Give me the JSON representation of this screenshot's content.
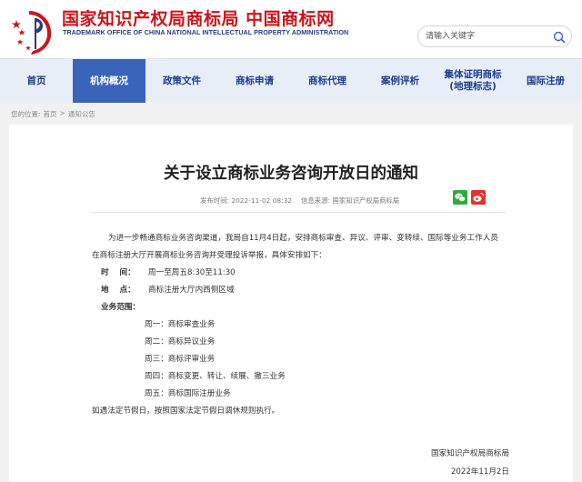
{
  "header": {
    "title": "国家知识产权局商标局 中国商标网",
    "subtitle": "TRADEMARK OFFICE OF CHINA NATIONAL INTELLECTUAL PROPERTY ADMINISTRATION",
    "search": {
      "placeholder": "请输入关键字"
    }
  },
  "nav": {
    "items": [
      {
        "label": "首页"
      },
      {
        "label": "机构概况",
        "active": true
      },
      {
        "label": "政策文件"
      },
      {
        "label": "商标申请"
      },
      {
        "label": "商标代理"
      },
      {
        "label": "案例评析"
      },
      {
        "label": "集体证明商标\n(地理标志)"
      },
      {
        "label": "国际注册"
      }
    ]
  },
  "breadcrumb": {
    "prefix": "您的位置:",
    "items": [
      "首页",
      "通知公告"
    ],
    "separator": ">"
  },
  "article": {
    "title": "关于设立商标业务咨询开放日的通知",
    "published": "发布时间: 2022-11-02 08:32",
    "source": "信息来源: 国家知识产权局商标局",
    "intro": "为进一步畅通商标业务咨询渠道，我局自11月4日起，安排商标审查、异议、评审、变转续、国际等业务工作人员在商标注册大厅开展商标业务咨询并受理投诉举报，具体安排如下：",
    "time_label": "时    间：",
    "time_value": "周一至周五8:30至11:30",
    "place_label": "地    点：",
    "place_value": "商标注册大厅内西侧区域",
    "scope_label": "业务范围：",
    "schedule": [
      "周一：商标审查业务",
      "周二：商标异议业务",
      "周三：商标评审业务",
      "周四：商标变更、转让、续展、撤三业务",
      "周五：商标国际注册业务"
    ],
    "holiday_note": "如遇法定节假日，按照国家法定节假日调休规则执行。",
    "signature": "国家知识产权局商标局",
    "date": "2022年11月2日"
  },
  "colors": {
    "brand_red": "#c8161d",
    "nav_active": "#3a64b9",
    "nav_text": "#1d3d8e"
  },
  "icons": {
    "emblem": "trademark-emblem-icon",
    "search": "search-icon",
    "wechat": "wechat-icon",
    "weibo": "weibo-icon"
  }
}
